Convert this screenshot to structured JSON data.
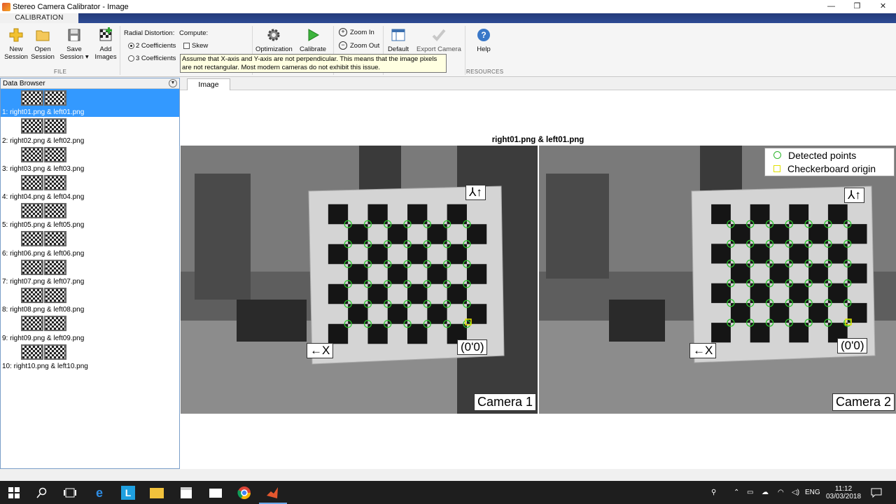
{
  "window": {
    "title": "Stereo Camera Calibrator - Image",
    "minimize": "—",
    "maximize": "❐",
    "close": "✕"
  },
  "ribbon": {
    "tab": "CALIBRATION",
    "file_tools": [
      {
        "label1": "New",
        "label2": "Session"
      },
      {
        "label1": "Open",
        "label2": "Session"
      },
      {
        "label1": "Save",
        "label2": "Session ▾"
      },
      {
        "label1": "Add",
        "label2": "Images"
      }
    ],
    "radial_distortion_label": "Radial Distortion:",
    "compute_label": "Compute:",
    "coeff2": "2 Coefficients",
    "coeff3": "3 Coefficients",
    "skew": "Skew",
    "optimization": "Optimization",
    "calibrate": "Calibrate",
    "zoom_in": "Zoom In",
    "zoom_out": "Zoom Out",
    "default": "Default",
    "export_camera": "Export Camera",
    "help": "Help",
    "sections": {
      "file": "FILE",
      "resources": "RESOURCES"
    }
  },
  "tooltip": {
    "line1": "Assume that X-axis and Y-axis are not perpendicular. This means that the image pixels",
    "line2": "are not rectangular. Most modern cameras do not exhibit this issue."
  },
  "data_browser": {
    "header": "Data Browser",
    "items": [
      "1: right01.png & left01.png",
      "2: right02.png & left02.png",
      "3: right03.png & left03.png",
      "4: right04.png & left04.png",
      "5: right05.png & left05.png",
      "6: right06.png & left06.png",
      "7: right07.png & left07.png",
      "8: right08.png & left08.png",
      "9: right09.png & left09.png",
      "10: right10.png & left10.png"
    ],
    "selected_index": 0
  },
  "main": {
    "tab": "Image",
    "figure_title": "right01.png & left01.png",
    "camera1": "Camera 1",
    "camera2": "Camera 2",
    "legend_detected": "Detected points",
    "legend_origin": "Checkerboard origin",
    "y_axis_label": "⅄↑",
    "x_axis_label": "←X",
    "origin_label": "(0'0)"
  },
  "taskbar": {
    "language": "ENG",
    "time": "11:12",
    "date": "03/03/2018"
  }
}
